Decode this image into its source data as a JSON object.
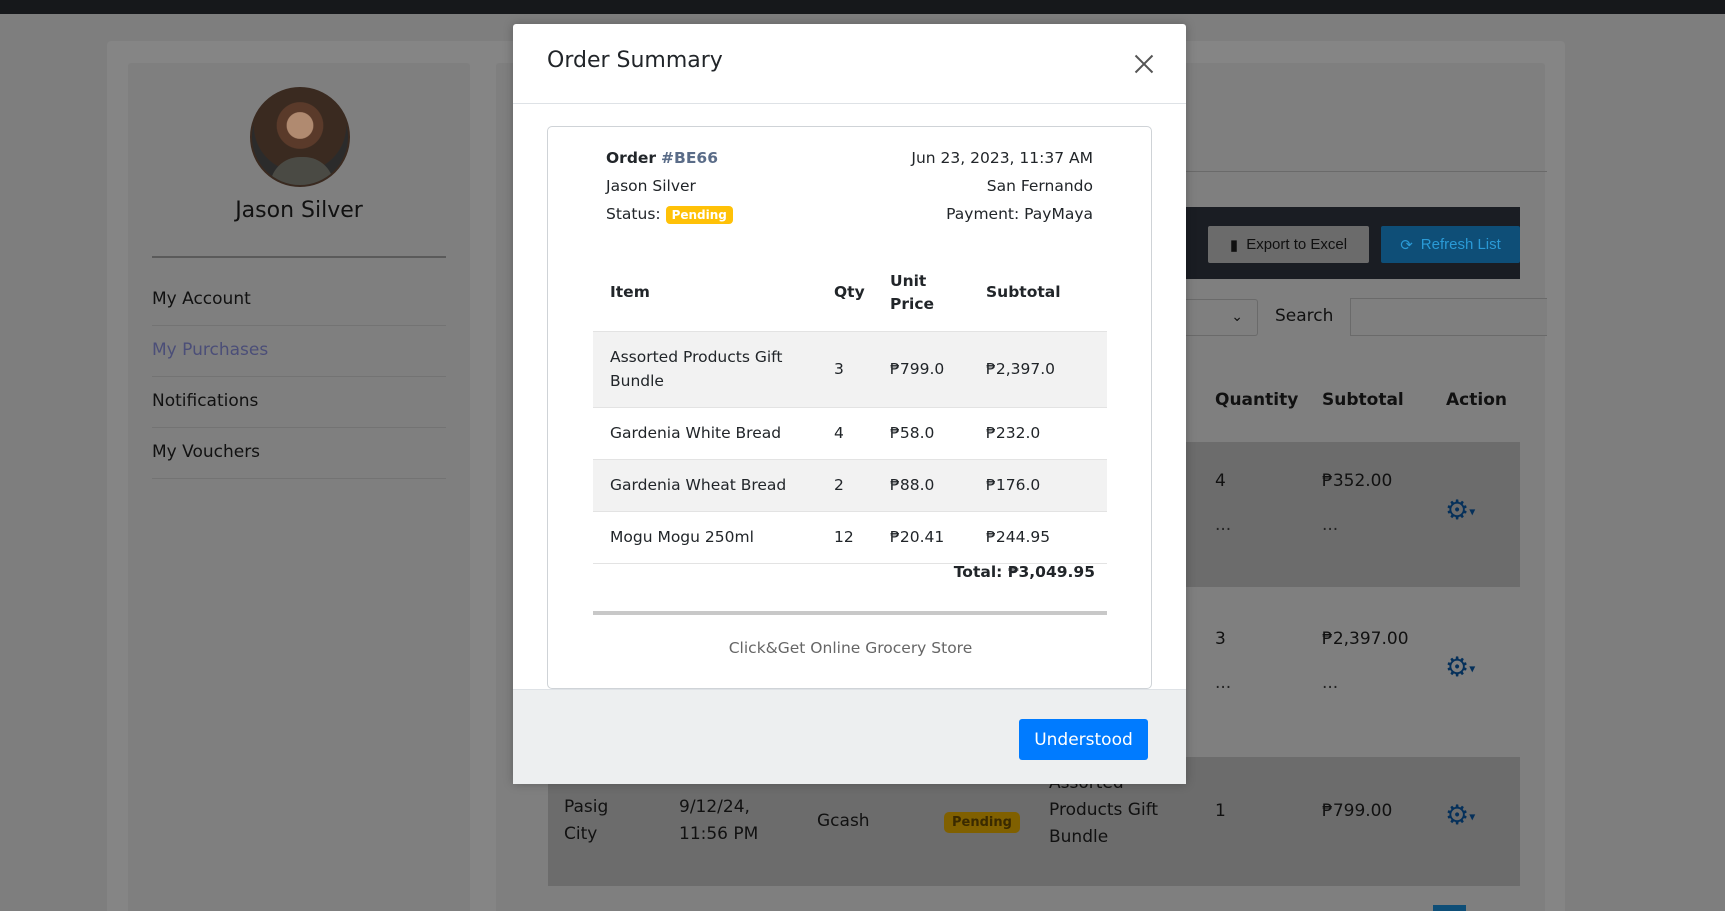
{
  "sidebar": {
    "user_name": "Jason Silver",
    "items": [
      {
        "label": "My Account"
      },
      {
        "label": "My Purchases"
      },
      {
        "label": "Notifications"
      },
      {
        "label": "My Vouchers"
      }
    ]
  },
  "toolbar": {
    "export_label": "Export to Excel",
    "refresh_label": "Refresh List",
    "search_label": "Search"
  },
  "table": {
    "headers": {
      "quantity": "Quantity",
      "subtotal": "Subtotal",
      "action": "Action"
    },
    "rows": [
      {
        "quantity": "4",
        "subtotal": "₱352.00",
        "more": "..."
      },
      {
        "quantity": "3",
        "subtotal": "₱2,397.00",
        "more": "..."
      },
      {
        "city": "Pasig City",
        "datetime": "9/12/24, 11:56 PM",
        "payment": "Gcash",
        "status": "Pending",
        "item": "Assorted Products Gift Bundle",
        "quantity": "1",
        "subtotal": "₱799.00"
      }
    ]
  },
  "modal": {
    "title": "Order Summary",
    "order_label": "Order",
    "order_number": "#BE66",
    "customer": "Jason Silver",
    "status_label": "Status:",
    "status": "Pending",
    "datetime": "Jun 23, 2023, 11:37 AM",
    "location": "San Fernando",
    "payment": "Payment: PayMaya",
    "columns": {
      "item": "Item",
      "qty": "Qty",
      "unit_price": "Unit Price",
      "subtotal": "Subtotal"
    },
    "items": [
      {
        "item": "Assorted Products Gift Bundle",
        "qty": "3",
        "unit_price": "₱799.0",
        "subtotal": "₱2,397.0"
      },
      {
        "item": "Gardenia White Bread",
        "qty": "4",
        "unit_price": "₱58.0",
        "subtotal": "₱232.0"
      },
      {
        "item": "Gardenia Wheat Bread",
        "qty": "2",
        "unit_price": "₱88.0",
        "subtotal": "₱176.0"
      },
      {
        "item": "Mogu Mogu 250ml",
        "qty": "12",
        "unit_price": "₱20.41",
        "subtotal": "₱244.95"
      }
    ],
    "total": "Total: ₱3,049.95",
    "store_name": "Click&Get Online Grocery Store",
    "button_label": "Understood"
  },
  "colors": {
    "primary": "#007bff",
    "pending": "#ffc107",
    "active_link": "#6f74b8"
  }
}
